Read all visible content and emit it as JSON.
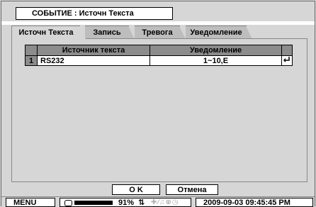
{
  "title": "СОБЫТИЕ : Источн Текста",
  "tabs": [
    {
      "label": "Источн Текста",
      "active": true
    },
    {
      "label": "Запись",
      "active": false
    },
    {
      "label": "Тревога",
      "active": false
    },
    {
      "label": "Уведомление",
      "active": false
    }
  ],
  "table": {
    "headers": {
      "source": "Источник текста",
      "notification": "Уведомление"
    },
    "rows": [
      {
        "index": "1",
        "source": "RS232",
        "notification": "1~10,E"
      }
    ]
  },
  "buttons": {
    "ok": "O K",
    "cancel": "Отмена"
  },
  "status": {
    "menu": "MENU",
    "hdd_percent": "91%",
    "datetime": "2009-09-03 09:45:45 PM"
  },
  "icons": {
    "enter": "enter-arrow-icon",
    "hdd": "hdd-icon",
    "network": "network-icon"
  },
  "colors": {
    "header_bg": "#8c8c8c",
    "panel_bg": "#d6d6d6",
    "inactive_tab": "#bdbdbd"
  }
}
